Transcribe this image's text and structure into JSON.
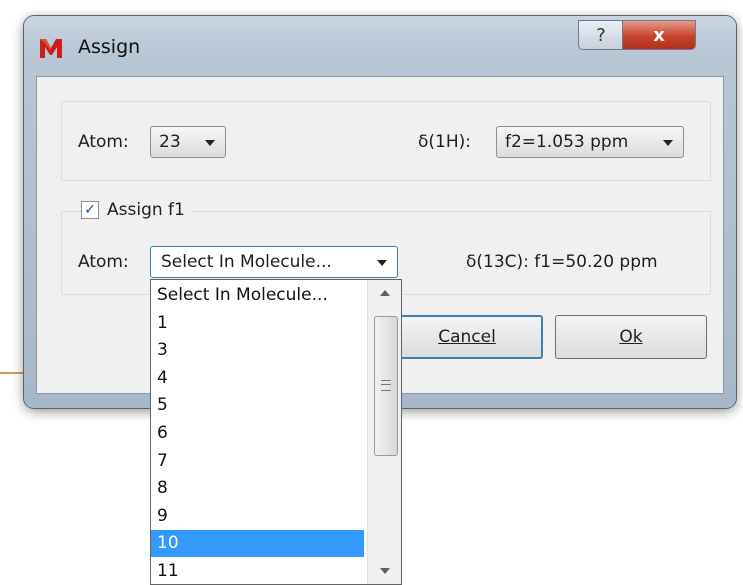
{
  "window": {
    "title": "Assign",
    "help_label": "?",
    "close_label": "x"
  },
  "group1": {
    "atom_label": "Atom:",
    "atom_value": "23",
    "shift_label": "δ(1H):",
    "shift_value": "f2=1.053 ppm"
  },
  "group2": {
    "checkbox_label": "Assign f1",
    "checkbox_checked": true,
    "atom_label": "Atom:",
    "atom_value": "Select In Molecule...",
    "shift_text": "δ(13C): f1=50.20 ppm"
  },
  "buttons": {
    "cancel_label": "Cancel",
    "ok_label": "Ok"
  },
  "dropdown": {
    "items": [
      "Select In Molecule...",
      "1",
      "3",
      "4",
      "5",
      "6",
      "7",
      "8",
      "9",
      "10",
      "11"
    ],
    "selected": "10"
  },
  "icons": {
    "app": "app-logo-icon",
    "dropdown_arrow": "chevron-down-icon",
    "check": "checkmark-icon"
  }
}
